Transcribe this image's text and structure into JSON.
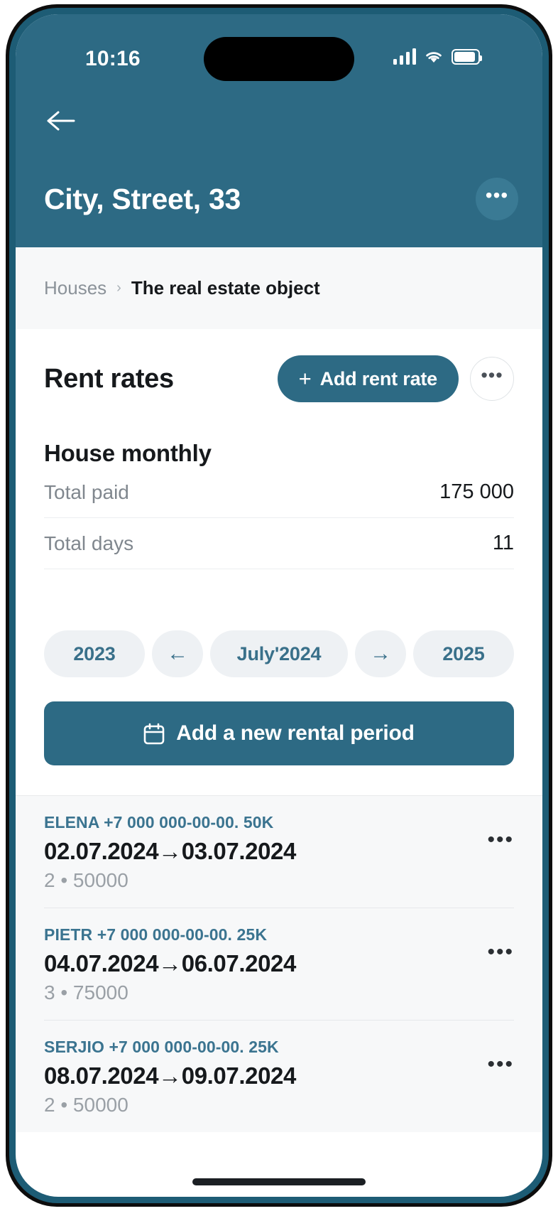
{
  "status_bar": {
    "time": "10:16",
    "signal_icon": "cellular-signal-icon",
    "wifi_icon": "wifi-icon",
    "battery_icon": "battery-icon"
  },
  "header": {
    "back_icon": "back-arrow-icon",
    "title": "City, Street, 33",
    "more_label": "•••",
    "background_color": "#2d6a84"
  },
  "breadcrumb": {
    "root": "Houses",
    "separator": "›",
    "current": "The real estate object"
  },
  "rent_rates": {
    "title": "Rent rates",
    "add_button_label": "Add rent rate",
    "add_button_plus": "+",
    "more_label": "•••",
    "rate_name": "House monthly",
    "stats": [
      {
        "label": "Total paid",
        "value": "175 000"
      },
      {
        "label": "Total days",
        "value": "11"
      }
    ]
  },
  "period_nav": {
    "prev_year": "2023",
    "prev_arrow": "←",
    "current_period": "July'2024",
    "next_arrow": "→",
    "next_year": "2025"
  },
  "add_rental_period": {
    "label": "Add a new rental period",
    "icon": "calendar-icon"
  },
  "rental_list": [
    {
      "contact": "ELENA +7 000 000-00-00. 50K",
      "dates": "02.07.2024→03.07.2024",
      "meta": "2 • 50000",
      "more_label": "•••"
    },
    {
      "contact": "PIETR +7 000 000-00-00. 25K",
      "dates": "04.07.2024→06.07.2024",
      "meta": "3 • 75000",
      "more_label": "•••"
    },
    {
      "contact": "SERJIO +7 000 000-00-00. 25K",
      "dates": "08.07.2024→09.07.2024",
      "meta": "2 • 50000",
      "more_label": "•••"
    }
  ],
  "colors": {
    "accent": "#2d6a84",
    "link": "#3b7490",
    "pill_bg": "#eef1f4",
    "panel_bg": "#f7f8f9"
  }
}
